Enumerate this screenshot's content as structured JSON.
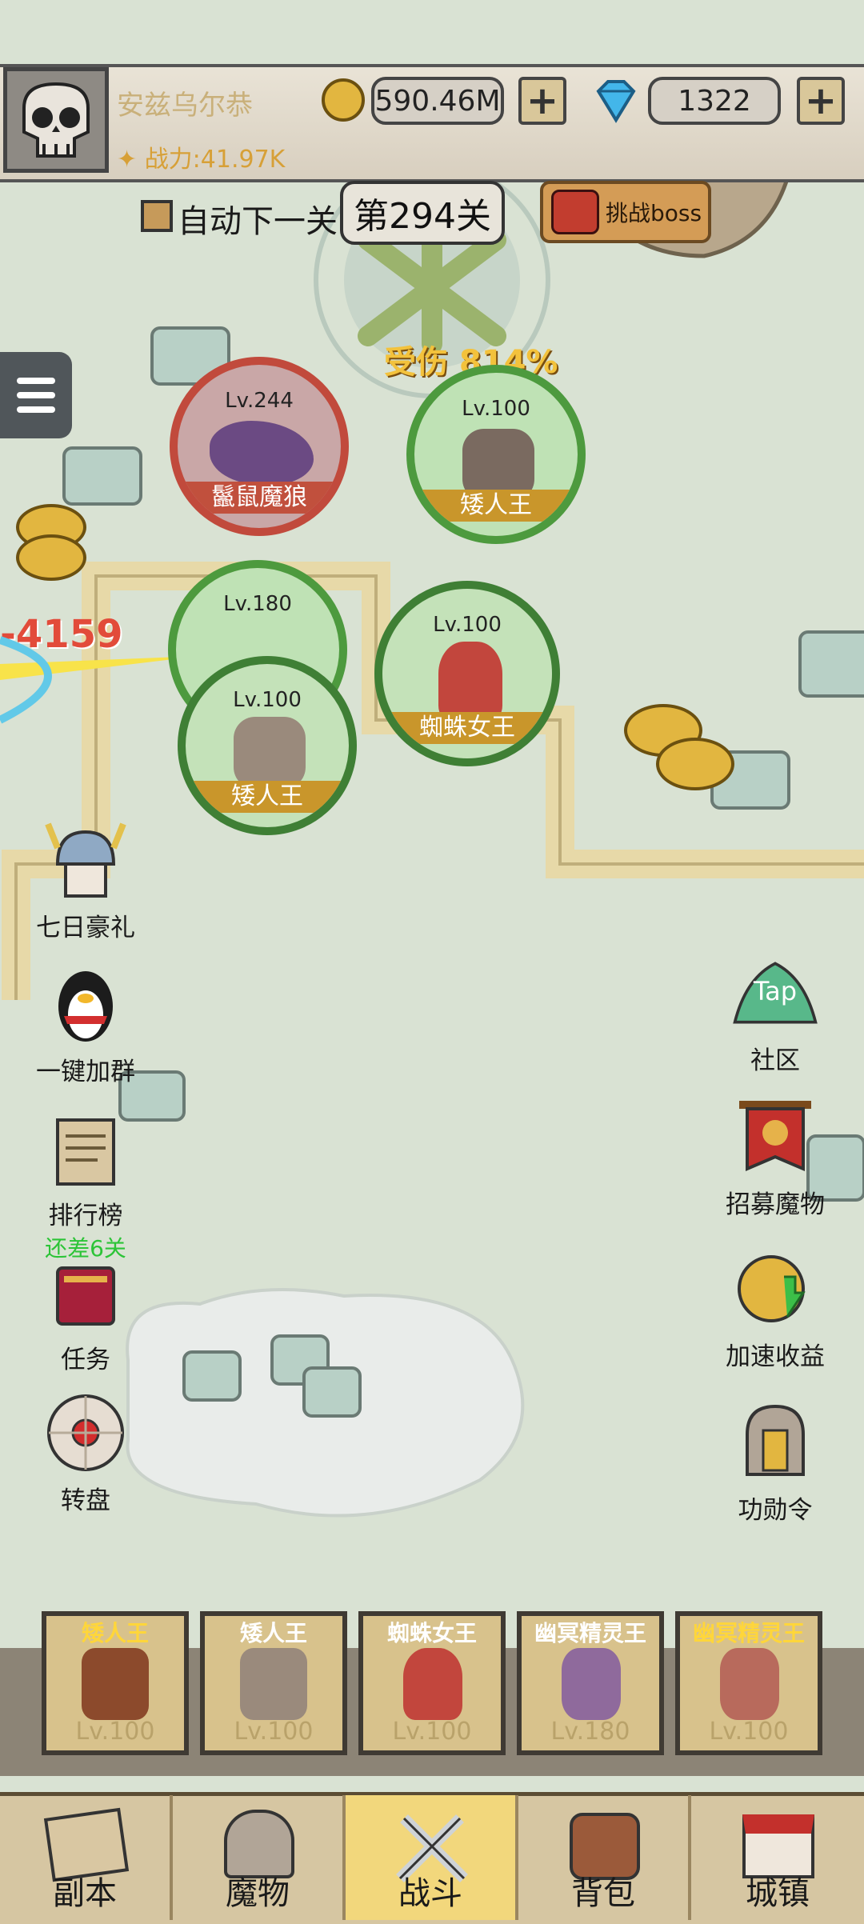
{
  "player": {
    "name": "安兹乌尔恭",
    "power": "战力:41.97K",
    "gold": "590.46M",
    "gems": "1322"
  },
  "level": {
    "auto_label": "自动下一关",
    "current": "第294关",
    "boss_label": "挑战boss"
  },
  "battle": {
    "damage_taken": "受伤 814%",
    "damage_number": "-4159",
    "units": [
      {
        "level": "Lv.244",
        "name": "鬣鼠魔狼"
      },
      {
        "level": "Lv.100",
        "name": "矮人王"
      },
      {
        "level": "Lv.180",
        "name": ""
      },
      {
        "level": "Lv.100",
        "name": "蜘蛛女王"
      },
      {
        "level": "Lv.100",
        "name": "矮人王"
      }
    ]
  },
  "left_menu": [
    {
      "label": "七日豪礼",
      "sub": ""
    },
    {
      "label": "一键加群",
      "sub": ""
    },
    {
      "label": "排行榜",
      "sub": "还差6关"
    },
    {
      "label": "任务",
      "sub": ""
    },
    {
      "label": "转盘",
      "sub": ""
    }
  ],
  "right_menu": [
    {
      "label": "社区",
      "icon_text": "Tap"
    },
    {
      "label": "招募魔物"
    },
    {
      "label": "加速收益"
    },
    {
      "label": "功勋令"
    }
  ],
  "team": [
    {
      "name": "矮人王",
      "level": "Lv.100"
    },
    {
      "name": "矮人王",
      "level": "Lv.100"
    },
    {
      "name": "蜘蛛女王",
      "level": "Lv.100"
    },
    {
      "name": "幽冥精灵王",
      "level": "Lv.180"
    },
    {
      "name": "幽冥精灵王",
      "level": "Lv.100"
    }
  ],
  "nav": [
    {
      "label": "副本"
    },
    {
      "label": "魔物"
    },
    {
      "label": "战斗",
      "active": true
    },
    {
      "label": "背包"
    },
    {
      "label": "城镇"
    }
  ]
}
